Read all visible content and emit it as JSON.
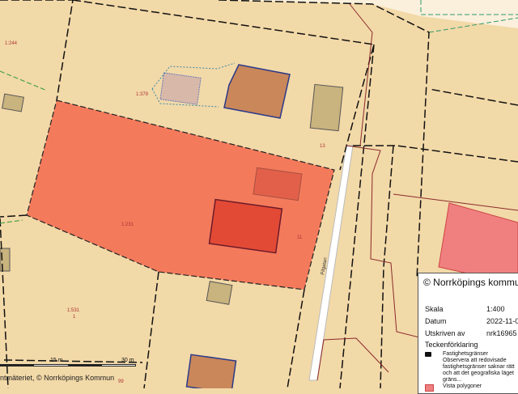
{
  "map": {
    "parcel_labels": [
      "1:244",
      "1:379",
      "13",
      "1:231",
      "11",
      "1:531",
      "1",
      "99"
    ],
    "road_label": "Pilgatan",
    "colors": {
      "background": "#f2d9a8",
      "selected_parcel": "#f47a5c",
      "building": "#c9875a",
      "highlight_building": "#e24a36",
      "road": "#ffffff",
      "vista_polygon": "#f08080"
    }
  },
  "scalebar": {
    "labels": [
      "15 m",
      "30 m"
    ]
  },
  "attribution": "ntmäteriet, © Norrköpings Kommun",
  "legend": {
    "title": "© Norrköpings kommun",
    "rows": [
      {
        "label": "Skala",
        "value": "1:400"
      },
      {
        "label": "Datum",
        "value": "2022-11-0"
      },
      {
        "label": "Utskriven av",
        "value": "nrk16965"
      }
    ],
    "subtitle": "Teckenförklaring",
    "items": [
      {
        "icon": "boundary-symbol",
        "lines": [
          "Fastighetsgränser",
          "Observera att redovisade",
          "fastighetsgränser saknar rätt",
          "och att det geografiska läget",
          "gräns..."
        ]
      },
      {
        "icon": "polygon-swatch",
        "lines": [
          "Vista polygoner"
        ]
      }
    ]
  }
}
